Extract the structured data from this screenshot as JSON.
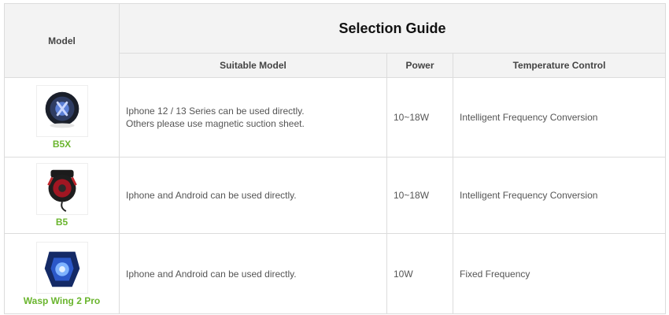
{
  "table": {
    "model_header": "Model",
    "title": "Selection Guide",
    "col_suitable": "Suitable Model",
    "col_power": "Power",
    "col_temp": "Temperature Control",
    "rows": [
      {
        "image": "magnetic-cooler-round-image",
        "name": "B5X",
        "suitable_line1": "Iphone 12 / 13 Series can be used directly.",
        "suitable_line2": "Others please use magnetic suction sheet.",
        "power": "10~18W",
        "temp": "Intelligent Frequency Conversion"
      },
      {
        "image": "clip-cooler-red-image",
        "name": "B5",
        "suitable_line1": "Iphone and Android can be used directly.",
        "power": "10~18W",
        "temp": "Intelligent Frequency Conversion"
      },
      {
        "image": "wasp-cooler-blue-image",
        "name": "Wasp Wing 2 Pro",
        "suitable_line1": "Iphone and Android can be used directly.",
        "power": "10W",
        "temp": "Fixed Frequency"
      }
    ]
  }
}
